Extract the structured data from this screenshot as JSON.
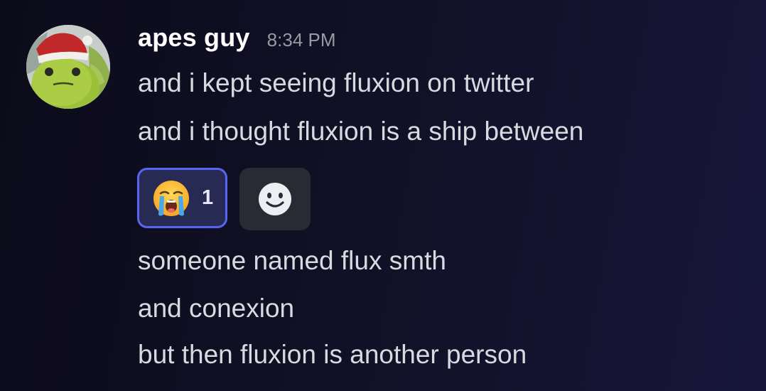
{
  "message": {
    "author": "apes guy",
    "timestamp": "8:34 PM",
    "avatar_icon": "frog-plush-santa-hat",
    "lines_before_reaction": [
      "and i kept seeing fluxion on twitter",
      "and i thought fluxion is a ship between"
    ],
    "lines_after_reaction": [
      "someone named flux smth",
      "and conexion",
      "but then fluxion is another person"
    ]
  },
  "reactions": [
    {
      "emoji_name": "loudly-crying-face",
      "count": "1",
      "selected": true
    }
  ],
  "add_reaction": {
    "icon": "smiley-face-icon"
  },
  "colors": {
    "username": "#ffffff",
    "message_text": "#d9d9e0",
    "timestamp": "#9a9aa5",
    "reaction_border": "#5865f2",
    "reaction_background": "#272a52",
    "add_reaction_background": "#2a2a34"
  }
}
